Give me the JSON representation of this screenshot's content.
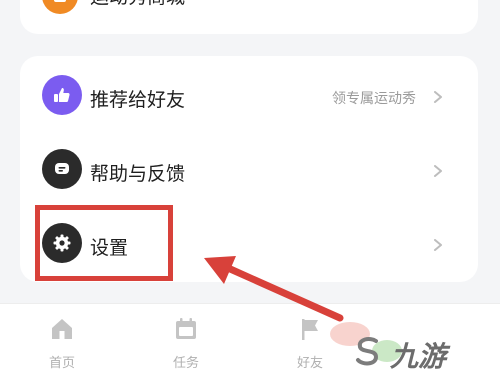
{
  "menu": {
    "top_item": {
      "label": "运动秀商城",
      "icon": "shop-icon"
    },
    "items": [
      {
        "label": "推荐给好友",
        "value": "领专属运动秀",
        "icon": "thumbs-up-icon",
        "icon_color": "#7b5cf0"
      },
      {
        "label": "帮助与反馈",
        "value": "",
        "icon": "chat-icon",
        "icon_color": "#2b2b2b"
      },
      {
        "label": "设置",
        "value": "",
        "icon": "gear-icon",
        "icon_color": "#2b2b2b"
      }
    ]
  },
  "tabbar": {
    "tabs": [
      {
        "label": "首页",
        "icon": "home-icon"
      },
      {
        "label": "任务",
        "icon": "calendar-icon"
      },
      {
        "label": "好友",
        "icon": "flag-icon"
      }
    ]
  },
  "annotation": {
    "highlight_color": "#d8413a",
    "arrow_color": "#d8413a"
  },
  "watermark": {
    "text": "九游",
    "icon": "s-logo-icon"
  }
}
